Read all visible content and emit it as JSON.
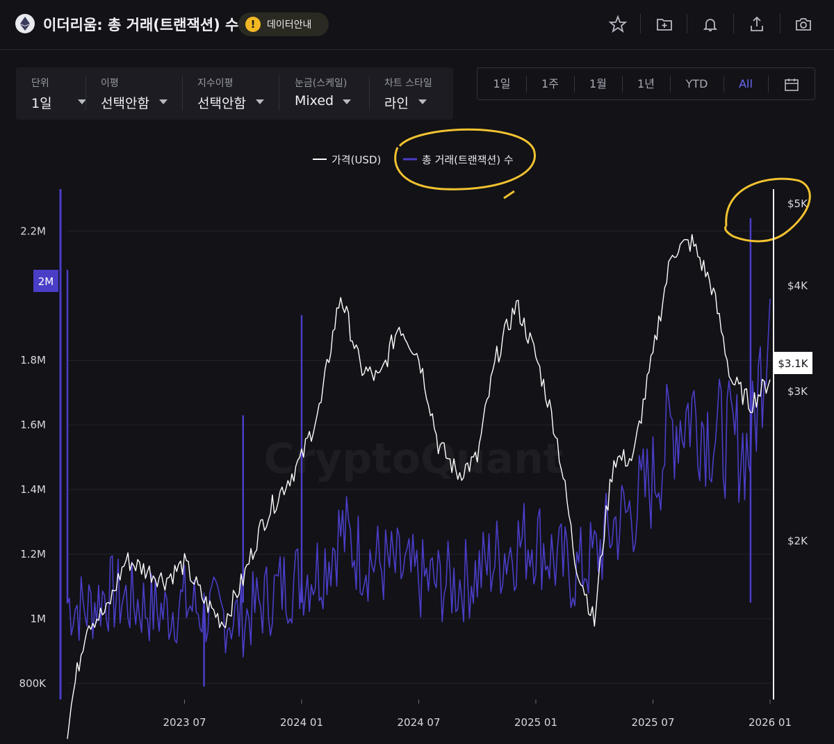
{
  "header": {
    "title": "이더리움: 총 거래(트랜잭션) 수",
    "data_guide_label": "데이터안내",
    "warning_glyph": "!",
    "tools": [
      "star-icon",
      "folder-add-icon",
      "bell-icon",
      "share-icon",
      "camera-icon"
    ]
  },
  "controls": [
    {
      "caption": "단위",
      "value": "1일"
    },
    {
      "caption": "이평",
      "value": "선택안함"
    },
    {
      "caption": "지수이평",
      "value": "선택안함"
    },
    {
      "caption": "눈금(스케일)",
      "value": "Mixed"
    },
    {
      "caption": "차트 스타일",
      "value": "라인"
    }
  ],
  "ranges": [
    "1일",
    "1주",
    "1월",
    "1년",
    "YTD",
    "All"
  ],
  "active_range": "All",
  "colors": {
    "background": "#121217",
    "price_line": "#ffffff",
    "tx_line": "#4a3ec7",
    "accent": "#6b6cf6",
    "annotation": "#f2c230"
  },
  "chart_data": {
    "type": "line",
    "watermark": "CryptoQuant",
    "legend": {
      "placement": "top-center",
      "entries": [
        "가격(USD)",
        "총 거래(트랜잭션) 수"
      ]
    },
    "x_ticks": [
      "2023 07",
      "2024 01",
      "2024 07",
      "2025 01",
      "2025 07",
      "2026 01"
    ],
    "x_range": [
      "2023-01",
      "2026-01"
    ],
    "y_left": {
      "label": "총 거래(트랜잭션) 수",
      "ticks": [
        "800K",
        "1M",
        "1.2M",
        "1.4M",
        "1.6M",
        "1.8M",
        "2.2M"
      ],
      "ylim": [
        750000,
        2330000
      ],
      "scale": "linear"
    },
    "y_right": {
      "label": "가격(USD)",
      "ticks": [
        "$2K",
        "$3K",
        "$4K",
        "$5K"
      ],
      "ylim": [
        1300,
        5200
      ],
      "scale": "log"
    },
    "cursor_labels": {
      "left": "2M",
      "right": "$3.1K"
    },
    "series": [
      {
        "name": "가격(USD)",
        "axis": "right",
        "x": [
          "2023-01",
          "2023-02",
          "2023-03",
          "2023-04",
          "2023-05",
          "2023-06",
          "2023-07",
          "2023-08",
          "2023-09",
          "2023-10",
          "2023-11",
          "2023-12",
          "2024-01",
          "2024-02",
          "2024-03",
          "2024-04",
          "2024-05",
          "2024-06",
          "2024-07",
          "2024-08",
          "2024-09",
          "2024-10",
          "2024-11",
          "2024-12",
          "2025-01",
          "2025-02",
          "2025-03",
          "2025-04",
          "2025-05",
          "2025-06",
          "2025-07",
          "2025-08",
          "2025-09",
          "2025-10",
          "2025-11",
          "2025-12",
          "2026-01"
        ],
        "values": [
          1200,
          1600,
          1650,
          1900,
          1850,
          1800,
          1880,
          1700,
          1600,
          1800,
          2100,
          2300,
          2500,
          2900,
          3900,
          3200,
          3100,
          3600,
          3300,
          2600,
          2400,
          2500,
          3300,
          3800,
          3300,
          2700,
          1900,
          1600,
          2500,
          2500,
          3300,
          4400,
          4500,
          4000,
          3100,
          2900,
          3100
        ]
      },
      {
        "name": "총 거래(트랜잭션) 수",
        "axis": "left",
        "x": [
          "2023-01",
          "2023-02",
          "2023-03",
          "2023-04",
          "2023-05",
          "2023-06",
          "2023-07",
          "2023-08",
          "2023-09",
          "2023-10",
          "2023-11",
          "2023-12",
          "2024-01",
          "2024-02",
          "2024-03",
          "2024-04",
          "2024-05",
          "2024-06",
          "2024-07",
          "2024-08",
          "2024-09",
          "2024-10",
          "2024-11",
          "2024-12",
          "2025-01",
          "2025-02",
          "2025-03",
          "2025-04",
          "2025-05",
          "2025-06",
          "2025-07",
          "2025-08",
          "2025-09",
          "2025-10",
          "2025-11",
          "2025-12",
          "2026-01"
        ],
        "values": [
          1050000,
          1030000,
          1080000,
          1060000,
          1040000,
          1020000,
          1050000,
          1020000,
          1010000,
          1000000,
          1050000,
          1100000,
          1130000,
          1160000,
          1270000,
          1200000,
          1170000,
          1150000,
          1120000,
          1110000,
          1110000,
          1140000,
          1190000,
          1230000,
          1250000,
          1180000,
          1140000,
          1190000,
          1290000,
          1340000,
          1430000,
          1600000,
          1650000,
          1580000,
          1550000,
          1520000,
          1990000
        ]
      }
    ],
    "spikes": [
      {
        "x": "2023-01",
        "value": 2080000
      },
      {
        "x": "2023-08",
        "value": 790000
      },
      {
        "x": "2023-10",
        "value": 1630000
      },
      {
        "x": "2024-01",
        "value": 1940000
      },
      {
        "x": "2025-12",
        "value": 2240000
      }
    ]
  }
}
